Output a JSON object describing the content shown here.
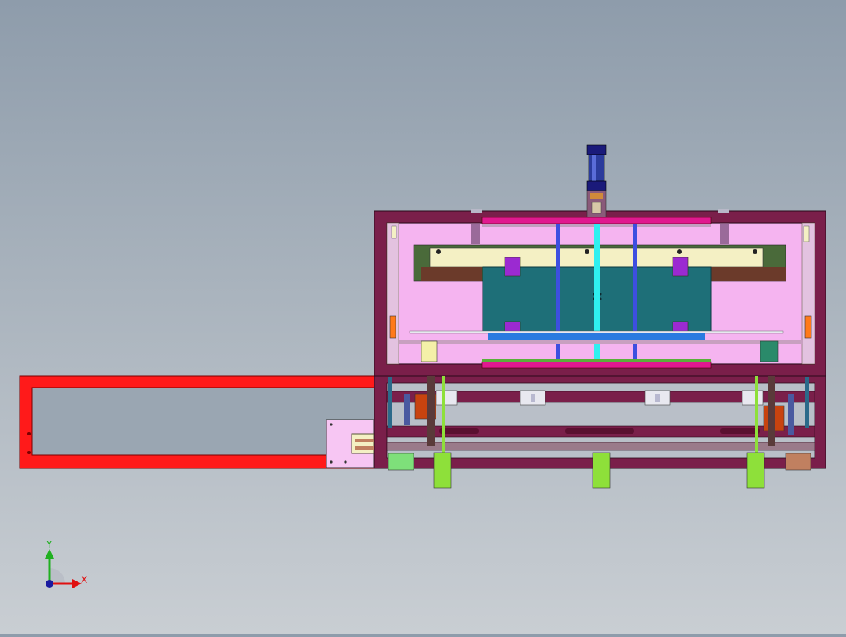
{
  "viewport": {
    "background_top": "#8e9cab",
    "background_bottom": "#c9ced3"
  },
  "model": {
    "colors": {
      "frame": "#7a1f4a",
      "frame_dark": "#4d0f2d",
      "chamber": "#f5b4f0",
      "red_rail": "#ff1a1a",
      "yellow_beam": "#f4f0c4",
      "teal_plate": "#1e6f78",
      "magenta_bar": "#e0198f",
      "purple_block": "#9b2ad1",
      "cylinder_blue": "#2b3b9c",
      "guide_blue": "#3d4fe0",
      "guide_cyan": "#2ff0f0",
      "green_cyl": "#8ee03a",
      "orange_block": "#c8430f",
      "tan_block": "#c08060",
      "light_green": "#7ee07a",
      "pink_plate": "#f7c6f3"
    }
  },
  "triad": {
    "x_label": "X",
    "y_label": "Y",
    "x_color": "#e01010",
    "y_color": "#20b020",
    "origin_color": "#1a1aa0"
  }
}
